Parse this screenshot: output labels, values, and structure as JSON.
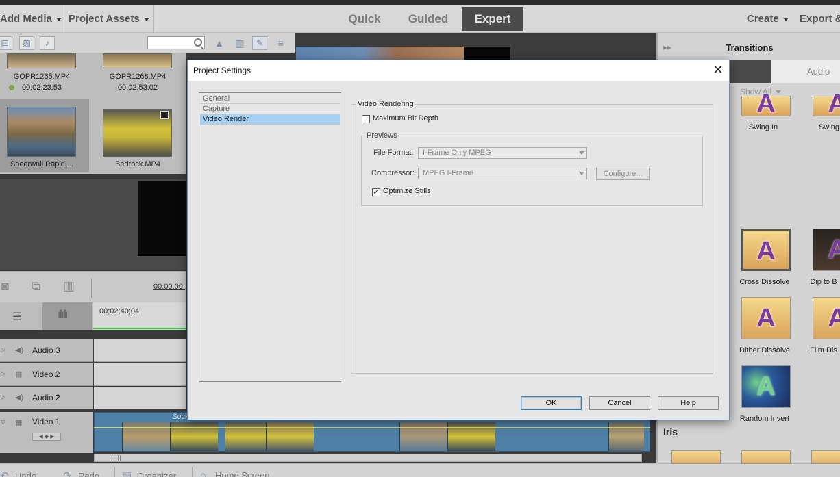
{
  "menubar": {
    "add_media": "Add Media",
    "project_assets": "Project Assets",
    "modes": [
      "Quick",
      "Guided",
      "Expert"
    ],
    "active_mode": "Expert",
    "create": "Create",
    "export": "Export &"
  },
  "assets": {
    "items": [
      {
        "name": "GOPR1265.MP4",
        "time": "00:02:23:53"
      },
      {
        "name": "GOPR1268.MP4",
        "time": "00:02:53:02"
      },
      {
        "name": "Sheerwall Rapid....",
        "time": ""
      },
      {
        "name": "Bedrock.MP4",
        "time": ""
      }
    ]
  },
  "timeline": {
    "timecode": "00;00;00;",
    "ruler_time": "00;02;40;04",
    "tracks": [
      {
        "name": "Audio 3"
      },
      {
        "name": "Video 2"
      },
      {
        "name": "Audio 2"
      },
      {
        "name": "Video 1"
      }
    ],
    "clip_label": "Sock"
  },
  "bottombar": {
    "undo": "Undo",
    "redo": "Redo",
    "organizer": "Organizer",
    "home_screen": "Home Screen"
  },
  "transitions": {
    "title": "Transitions",
    "tab_audio": "Audio",
    "filter": "Show All",
    "items": [
      {
        "label": "Swing In"
      },
      {
        "label": "Swing"
      },
      {
        "label": "Cross Dissolve"
      },
      {
        "label": "Dip to B"
      },
      {
        "label": "Dither Dissolve"
      },
      {
        "label": "Film Dis"
      },
      {
        "label": "Random Invert"
      }
    ],
    "section_iris": "Iris"
  },
  "dialog": {
    "title": "Project Settings",
    "nav": [
      "General",
      "Capture",
      "Video Render"
    ],
    "active_nav": "Video Render",
    "group_title": "Video Rendering",
    "max_bit_depth_label": "Maximum Bit Depth",
    "max_bit_depth_checked": false,
    "previews_title": "Previews",
    "file_format_label": "File Format:",
    "file_format_value": "I-Frame Only MPEG",
    "compressor_label": "Compressor:",
    "compressor_value": "MPEG I-Frame",
    "configure_label": "Configure...",
    "optimize_stills_label": "Optimize Stills",
    "optimize_stills_checked": true,
    "ok": "OK",
    "cancel": "Cancel",
    "help": "Help"
  },
  "colors": {
    "accent_selected": "#a6d1f2",
    "timeline_clip": "#4e7fa4",
    "playhead": "#3cc43c"
  }
}
